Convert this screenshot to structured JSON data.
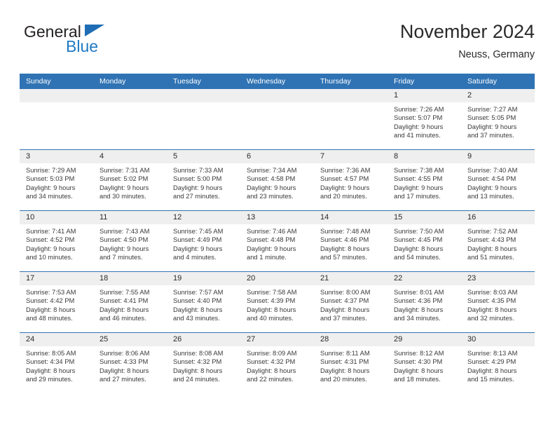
{
  "brand": {
    "name_part1": "General",
    "name_part2": "Blue",
    "mark": "triangle-flag-icon"
  },
  "header": {
    "title": "November 2024",
    "subtitle": "Neuss, Germany"
  },
  "colors": {
    "header_blue": "#3073b4",
    "brand_blue": "#1f7ac4",
    "day_band_gray": "#efefef",
    "text": "#2a2a2a"
  },
  "weekdays": [
    "Sunday",
    "Monday",
    "Tuesday",
    "Wednesday",
    "Thursday",
    "Friday",
    "Saturday"
  ],
  "weeks": [
    [
      {
        "day": "",
        "sunrise": "",
        "sunset": "",
        "daylight1": "",
        "daylight2": ""
      },
      {
        "day": "",
        "sunrise": "",
        "sunset": "",
        "daylight1": "",
        "daylight2": ""
      },
      {
        "day": "",
        "sunrise": "",
        "sunset": "",
        "daylight1": "",
        "daylight2": ""
      },
      {
        "day": "",
        "sunrise": "",
        "sunset": "",
        "daylight1": "",
        "daylight2": ""
      },
      {
        "day": "",
        "sunrise": "",
        "sunset": "",
        "daylight1": "",
        "daylight2": ""
      },
      {
        "day": "1",
        "sunrise": "Sunrise: 7:26 AM",
        "sunset": "Sunset: 5:07 PM",
        "daylight1": "Daylight: 9 hours",
        "daylight2": "and 41 minutes."
      },
      {
        "day": "2",
        "sunrise": "Sunrise: 7:27 AM",
        "sunset": "Sunset: 5:05 PM",
        "daylight1": "Daylight: 9 hours",
        "daylight2": "and 37 minutes."
      }
    ],
    [
      {
        "day": "3",
        "sunrise": "Sunrise: 7:29 AM",
        "sunset": "Sunset: 5:03 PM",
        "daylight1": "Daylight: 9 hours",
        "daylight2": "and 34 minutes."
      },
      {
        "day": "4",
        "sunrise": "Sunrise: 7:31 AM",
        "sunset": "Sunset: 5:02 PM",
        "daylight1": "Daylight: 9 hours",
        "daylight2": "and 30 minutes."
      },
      {
        "day": "5",
        "sunrise": "Sunrise: 7:33 AM",
        "sunset": "Sunset: 5:00 PM",
        "daylight1": "Daylight: 9 hours",
        "daylight2": "and 27 minutes."
      },
      {
        "day": "6",
        "sunrise": "Sunrise: 7:34 AM",
        "sunset": "Sunset: 4:58 PM",
        "daylight1": "Daylight: 9 hours",
        "daylight2": "and 23 minutes."
      },
      {
        "day": "7",
        "sunrise": "Sunrise: 7:36 AM",
        "sunset": "Sunset: 4:57 PM",
        "daylight1": "Daylight: 9 hours",
        "daylight2": "and 20 minutes."
      },
      {
        "day": "8",
        "sunrise": "Sunrise: 7:38 AM",
        "sunset": "Sunset: 4:55 PM",
        "daylight1": "Daylight: 9 hours",
        "daylight2": "and 17 minutes."
      },
      {
        "day": "9",
        "sunrise": "Sunrise: 7:40 AM",
        "sunset": "Sunset: 4:54 PM",
        "daylight1": "Daylight: 9 hours",
        "daylight2": "and 13 minutes."
      }
    ],
    [
      {
        "day": "10",
        "sunrise": "Sunrise: 7:41 AM",
        "sunset": "Sunset: 4:52 PM",
        "daylight1": "Daylight: 9 hours",
        "daylight2": "and 10 minutes."
      },
      {
        "day": "11",
        "sunrise": "Sunrise: 7:43 AM",
        "sunset": "Sunset: 4:50 PM",
        "daylight1": "Daylight: 9 hours",
        "daylight2": "and 7 minutes."
      },
      {
        "day": "12",
        "sunrise": "Sunrise: 7:45 AM",
        "sunset": "Sunset: 4:49 PM",
        "daylight1": "Daylight: 9 hours",
        "daylight2": "and 4 minutes."
      },
      {
        "day": "13",
        "sunrise": "Sunrise: 7:46 AM",
        "sunset": "Sunset: 4:48 PM",
        "daylight1": "Daylight: 9 hours",
        "daylight2": "and 1 minute."
      },
      {
        "day": "14",
        "sunrise": "Sunrise: 7:48 AM",
        "sunset": "Sunset: 4:46 PM",
        "daylight1": "Daylight: 8 hours",
        "daylight2": "and 57 minutes."
      },
      {
        "day": "15",
        "sunrise": "Sunrise: 7:50 AM",
        "sunset": "Sunset: 4:45 PM",
        "daylight1": "Daylight: 8 hours",
        "daylight2": "and 54 minutes."
      },
      {
        "day": "16",
        "sunrise": "Sunrise: 7:52 AM",
        "sunset": "Sunset: 4:43 PM",
        "daylight1": "Daylight: 8 hours",
        "daylight2": "and 51 minutes."
      }
    ],
    [
      {
        "day": "17",
        "sunrise": "Sunrise: 7:53 AM",
        "sunset": "Sunset: 4:42 PM",
        "daylight1": "Daylight: 8 hours",
        "daylight2": "and 48 minutes."
      },
      {
        "day": "18",
        "sunrise": "Sunrise: 7:55 AM",
        "sunset": "Sunset: 4:41 PM",
        "daylight1": "Daylight: 8 hours",
        "daylight2": "and 46 minutes."
      },
      {
        "day": "19",
        "sunrise": "Sunrise: 7:57 AM",
        "sunset": "Sunset: 4:40 PM",
        "daylight1": "Daylight: 8 hours",
        "daylight2": "and 43 minutes."
      },
      {
        "day": "20",
        "sunrise": "Sunrise: 7:58 AM",
        "sunset": "Sunset: 4:39 PM",
        "daylight1": "Daylight: 8 hours",
        "daylight2": "and 40 minutes."
      },
      {
        "day": "21",
        "sunrise": "Sunrise: 8:00 AM",
        "sunset": "Sunset: 4:37 PM",
        "daylight1": "Daylight: 8 hours",
        "daylight2": "and 37 minutes."
      },
      {
        "day": "22",
        "sunrise": "Sunrise: 8:01 AM",
        "sunset": "Sunset: 4:36 PM",
        "daylight1": "Daylight: 8 hours",
        "daylight2": "and 34 minutes."
      },
      {
        "day": "23",
        "sunrise": "Sunrise: 8:03 AM",
        "sunset": "Sunset: 4:35 PM",
        "daylight1": "Daylight: 8 hours",
        "daylight2": "and 32 minutes."
      }
    ],
    [
      {
        "day": "24",
        "sunrise": "Sunrise: 8:05 AM",
        "sunset": "Sunset: 4:34 PM",
        "daylight1": "Daylight: 8 hours",
        "daylight2": "and 29 minutes."
      },
      {
        "day": "25",
        "sunrise": "Sunrise: 8:06 AM",
        "sunset": "Sunset: 4:33 PM",
        "daylight1": "Daylight: 8 hours",
        "daylight2": "and 27 minutes."
      },
      {
        "day": "26",
        "sunrise": "Sunrise: 8:08 AM",
        "sunset": "Sunset: 4:32 PM",
        "daylight1": "Daylight: 8 hours",
        "daylight2": "and 24 minutes."
      },
      {
        "day": "27",
        "sunrise": "Sunrise: 8:09 AM",
        "sunset": "Sunset: 4:32 PM",
        "daylight1": "Daylight: 8 hours",
        "daylight2": "and 22 minutes."
      },
      {
        "day": "28",
        "sunrise": "Sunrise: 8:11 AM",
        "sunset": "Sunset: 4:31 PM",
        "daylight1": "Daylight: 8 hours",
        "daylight2": "and 20 minutes."
      },
      {
        "day": "29",
        "sunrise": "Sunrise: 8:12 AM",
        "sunset": "Sunset: 4:30 PM",
        "daylight1": "Daylight: 8 hours",
        "daylight2": "and 18 minutes."
      },
      {
        "day": "30",
        "sunrise": "Sunrise: 8:13 AM",
        "sunset": "Sunset: 4:29 PM",
        "daylight1": "Daylight: 8 hours",
        "daylight2": "and 15 minutes."
      }
    ]
  ]
}
